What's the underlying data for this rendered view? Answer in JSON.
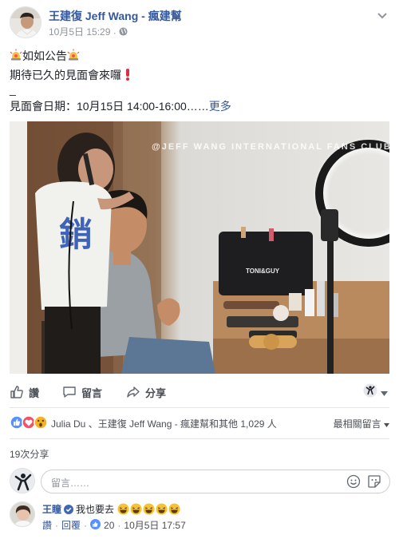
{
  "header": {
    "page_name": "王建復 Jeff Wang - 瘋建幫",
    "date": "10月5日 15:29",
    "separator": "·"
  },
  "post": {
    "line1": "如如公告",
    "line2": "期待已久的見面會來囉",
    "line3": "_",
    "line4": "見面會日期：10月15日 14:00-16:00……",
    "more_link": "更多",
    "photo_watermark": "@JEFF WANG INTERNATIONAL FANS CLUB",
    "photo_bag_brand": "TONI&GUY",
    "photo_shirt_text": "銷"
  },
  "actions": {
    "like": "讚",
    "comment": "留言",
    "share": "分享"
  },
  "reactions": {
    "names": "Julia Du 、王建復 Jeff Wang - 瘋建幫和其他 1,029 人",
    "sort": "最相關留言"
  },
  "shares": "19次分享",
  "comment_box": {
    "placeholder": "留言……"
  },
  "comment": {
    "author": "王瞳",
    "text": "我也要去",
    "like": "讚",
    "reply": "回覆",
    "likes": "20",
    "date": "10月5日 17:57"
  },
  "colors": {
    "link": "#365899",
    "text": "#1d2129",
    "muted": "#90949c",
    "like_blue": "#5890ff",
    "love_red": "#f25268",
    "wow_yellow": "#f7b125"
  }
}
